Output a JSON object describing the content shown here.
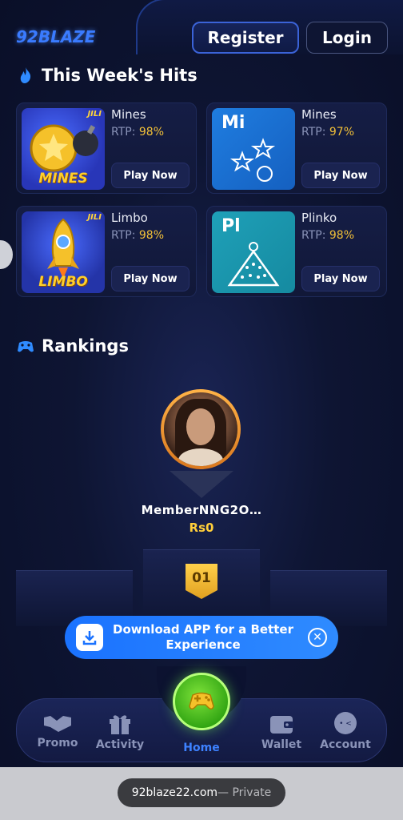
{
  "header": {
    "logo_text": "92BLAZE",
    "register_label": "Register",
    "login_label": "Login"
  },
  "hits": {
    "title": "This Week's Hits",
    "games": [
      {
        "name": "Mines",
        "rtp_label": "RTP:",
        "rtp_value": "98%",
        "play_label": "Play Now",
        "thumb_brand": "JILI",
        "thumb_word": "MINES"
      },
      {
        "name": "Mines",
        "rtp_label": "RTP:",
        "rtp_value": "97%",
        "play_label": "Play Now",
        "tile_abbr": "Mi"
      },
      {
        "name": "Limbo",
        "rtp_label": "RTP:",
        "rtp_value": "98%",
        "play_label": "Play Now",
        "thumb_brand": "JILI",
        "thumb_word": "LIMBO"
      },
      {
        "name": "Plinko",
        "rtp_label": "RTP:",
        "rtp_value": "98%",
        "play_label": "Play Now",
        "tile_abbr": "Pl"
      }
    ]
  },
  "rankings": {
    "title": "Rankings",
    "top": {
      "member": "MemberNNG2O…",
      "amount": "Rs0",
      "rank": "01"
    }
  },
  "download_banner": {
    "text_line1": "Download APP for a Better",
    "text_line2": "Experience"
  },
  "bottom_nav": {
    "items": [
      {
        "label": "Promo",
        "icon": "handshake-icon"
      },
      {
        "label": "Activity",
        "icon": "gift-icon"
      },
      {
        "label": "Home",
        "icon": "gamepad-icon"
      },
      {
        "label": "Wallet",
        "icon": "wallet-icon"
      },
      {
        "label": "Account",
        "icon": "account-icon"
      }
    ]
  },
  "browser": {
    "url": "92blaze22.com",
    "mode": " — Private"
  },
  "colors": {
    "accent": "#3d82ff",
    "rtp": "#f2c038",
    "home_green": "#4fc31e"
  }
}
